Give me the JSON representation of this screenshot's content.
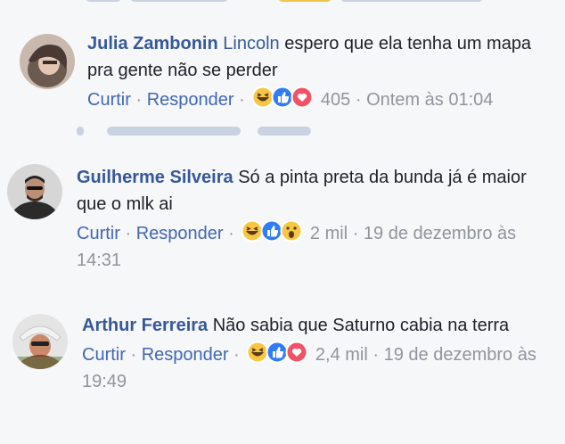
{
  "comments": [
    {
      "author": "Julia Zambonin",
      "mention": "Lincoln",
      "text": "espero que ela tenha um mapa pra gente não se perder",
      "like_label": "Curtir",
      "reply_label": "Responder",
      "reaction_count": "405",
      "timestamp": "Ontem às 01:04",
      "reactions": [
        "haha",
        "like",
        "love"
      ]
    },
    {
      "author": "Guilherme Silveira",
      "mention": "",
      "text": "Só a pinta preta da bunda já é maior que o mlk ai",
      "like_label": "Curtir",
      "reply_label": "Responder",
      "reaction_count": "2 mil",
      "timestamp": "19 de dezembro às 14:31",
      "reactions": [
        "haha",
        "like",
        "wow"
      ]
    },
    {
      "author": "Arthur Ferreira",
      "mention": "",
      "text": "Não sabia que Saturno cabia na terra",
      "like_label": "Curtir",
      "reply_label": "Responder",
      "reaction_count": "2,4 mil",
      "timestamp": "19 de dezembro às 19:49",
      "reactions": [
        "haha",
        "like",
        "love"
      ]
    }
  ],
  "separator": "·",
  "colors": {
    "background": "#f6f7f9",
    "author": "#365899",
    "link": "#4267b2",
    "meta": "#90949c",
    "text": "#1d2129"
  },
  "icons": {
    "haha": "haha-reaction-icon",
    "like": "like-reaction-icon",
    "love": "love-reaction-icon",
    "wow": "wow-reaction-icon"
  }
}
